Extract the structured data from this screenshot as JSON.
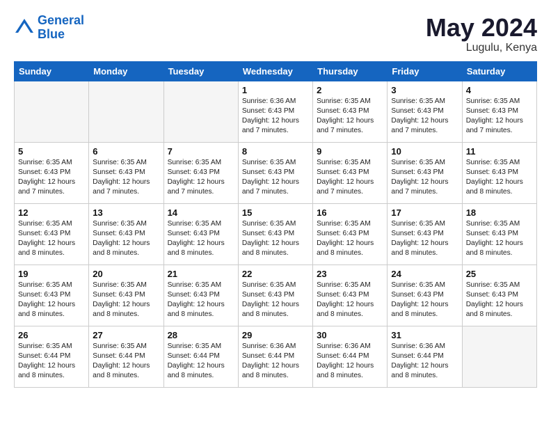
{
  "header": {
    "logo_line1": "General",
    "logo_line2": "Blue",
    "month": "May 2024",
    "location": "Lugulu, Kenya"
  },
  "weekdays": [
    "Sunday",
    "Monday",
    "Tuesday",
    "Wednesday",
    "Thursday",
    "Friday",
    "Saturday"
  ],
  "weeks": [
    [
      {
        "day": "",
        "empty": true
      },
      {
        "day": "",
        "empty": true
      },
      {
        "day": "",
        "empty": true
      },
      {
        "day": "1",
        "sunrise": "6:36 AM",
        "sunset": "6:43 PM",
        "daylight": "12 hours and 7 minutes."
      },
      {
        "day": "2",
        "sunrise": "6:35 AM",
        "sunset": "6:43 PM",
        "daylight": "12 hours and 7 minutes."
      },
      {
        "day": "3",
        "sunrise": "6:35 AM",
        "sunset": "6:43 PM",
        "daylight": "12 hours and 7 minutes."
      },
      {
        "day": "4",
        "sunrise": "6:35 AM",
        "sunset": "6:43 PM",
        "daylight": "12 hours and 7 minutes."
      }
    ],
    [
      {
        "day": "5",
        "sunrise": "6:35 AM",
        "sunset": "6:43 PM",
        "daylight": "12 hours and 7 minutes."
      },
      {
        "day": "6",
        "sunrise": "6:35 AM",
        "sunset": "6:43 PM",
        "daylight": "12 hours and 7 minutes."
      },
      {
        "day": "7",
        "sunrise": "6:35 AM",
        "sunset": "6:43 PM",
        "daylight": "12 hours and 7 minutes."
      },
      {
        "day": "8",
        "sunrise": "6:35 AM",
        "sunset": "6:43 PM",
        "daylight": "12 hours and 7 minutes."
      },
      {
        "day": "9",
        "sunrise": "6:35 AM",
        "sunset": "6:43 PM",
        "daylight": "12 hours and 7 minutes."
      },
      {
        "day": "10",
        "sunrise": "6:35 AM",
        "sunset": "6:43 PM",
        "daylight": "12 hours and 7 minutes."
      },
      {
        "day": "11",
        "sunrise": "6:35 AM",
        "sunset": "6:43 PM",
        "daylight": "12 hours and 8 minutes."
      }
    ],
    [
      {
        "day": "12",
        "sunrise": "6:35 AM",
        "sunset": "6:43 PM",
        "daylight": "12 hours and 8 minutes."
      },
      {
        "day": "13",
        "sunrise": "6:35 AM",
        "sunset": "6:43 PM",
        "daylight": "12 hours and 8 minutes."
      },
      {
        "day": "14",
        "sunrise": "6:35 AM",
        "sunset": "6:43 PM",
        "daylight": "12 hours and 8 minutes."
      },
      {
        "day": "15",
        "sunrise": "6:35 AM",
        "sunset": "6:43 PM",
        "daylight": "12 hours and 8 minutes."
      },
      {
        "day": "16",
        "sunrise": "6:35 AM",
        "sunset": "6:43 PM",
        "daylight": "12 hours and 8 minutes."
      },
      {
        "day": "17",
        "sunrise": "6:35 AM",
        "sunset": "6:43 PM",
        "daylight": "12 hours and 8 minutes."
      },
      {
        "day": "18",
        "sunrise": "6:35 AM",
        "sunset": "6:43 PM",
        "daylight": "12 hours and 8 minutes."
      }
    ],
    [
      {
        "day": "19",
        "sunrise": "6:35 AM",
        "sunset": "6:43 PM",
        "daylight": "12 hours and 8 minutes."
      },
      {
        "day": "20",
        "sunrise": "6:35 AM",
        "sunset": "6:43 PM",
        "daylight": "12 hours and 8 minutes."
      },
      {
        "day": "21",
        "sunrise": "6:35 AM",
        "sunset": "6:43 PM",
        "daylight": "12 hours and 8 minutes."
      },
      {
        "day": "22",
        "sunrise": "6:35 AM",
        "sunset": "6:43 PM",
        "daylight": "12 hours and 8 minutes."
      },
      {
        "day": "23",
        "sunrise": "6:35 AM",
        "sunset": "6:43 PM",
        "daylight": "12 hours and 8 minutes."
      },
      {
        "day": "24",
        "sunrise": "6:35 AM",
        "sunset": "6:43 PM",
        "daylight": "12 hours and 8 minutes."
      },
      {
        "day": "25",
        "sunrise": "6:35 AM",
        "sunset": "6:43 PM",
        "daylight": "12 hours and 8 minutes."
      }
    ],
    [
      {
        "day": "26",
        "sunrise": "6:35 AM",
        "sunset": "6:44 PM",
        "daylight": "12 hours and 8 minutes."
      },
      {
        "day": "27",
        "sunrise": "6:35 AM",
        "sunset": "6:44 PM",
        "daylight": "12 hours and 8 minutes."
      },
      {
        "day": "28",
        "sunrise": "6:35 AM",
        "sunset": "6:44 PM",
        "daylight": "12 hours and 8 minutes."
      },
      {
        "day": "29",
        "sunrise": "6:36 AM",
        "sunset": "6:44 PM",
        "daylight": "12 hours and 8 minutes."
      },
      {
        "day": "30",
        "sunrise": "6:36 AM",
        "sunset": "6:44 PM",
        "daylight": "12 hours and 8 minutes."
      },
      {
        "day": "31",
        "sunrise": "6:36 AM",
        "sunset": "6:44 PM",
        "daylight": "12 hours and 8 minutes."
      },
      {
        "day": "",
        "empty": true
      }
    ]
  ],
  "labels": {
    "sunrise": "Sunrise:",
    "sunset": "Sunset:",
    "daylight": "Daylight:"
  }
}
